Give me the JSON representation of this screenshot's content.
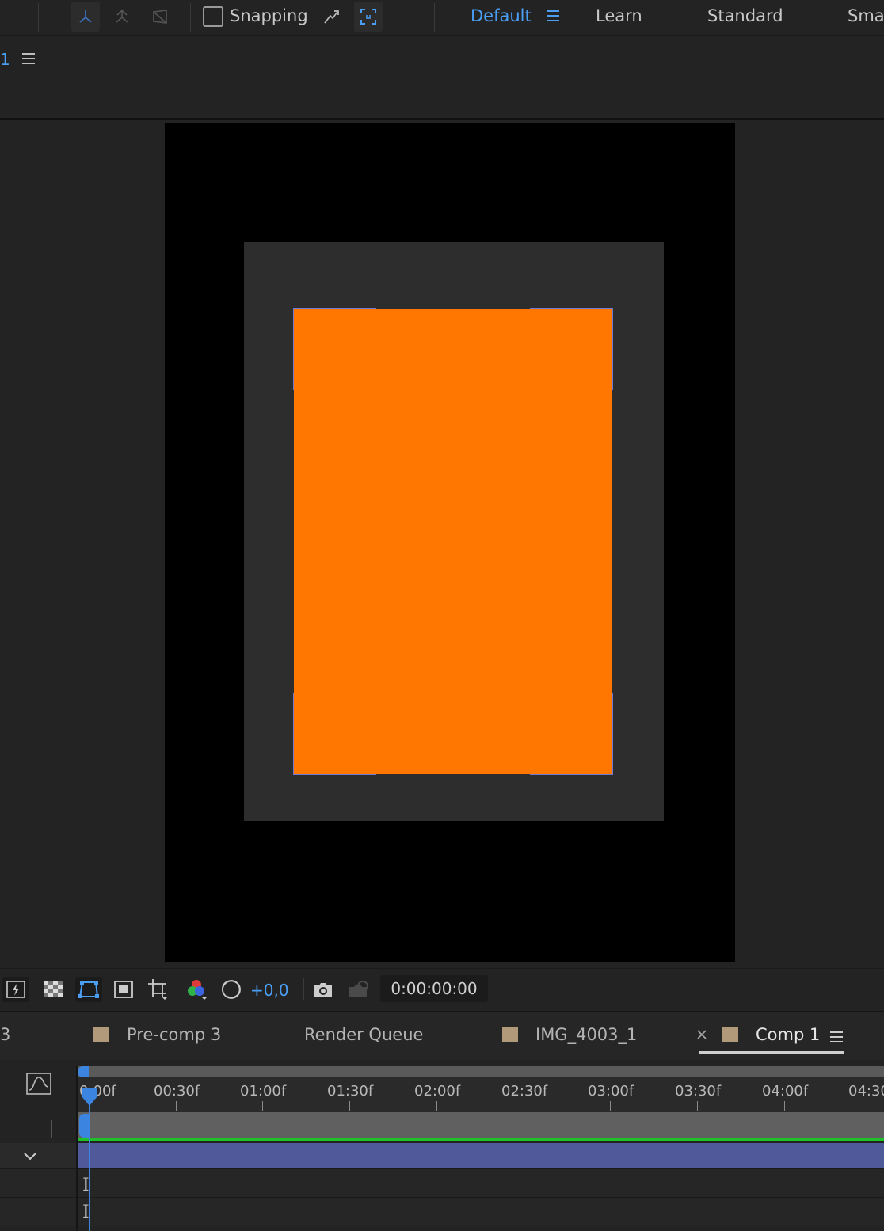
{
  "toolbar": {
    "snapping_label": "Snapping",
    "workspaces": [
      "Default",
      "Learn",
      "Standard",
      "Smal"
    ],
    "active_workspace": "Default",
    "accent": "#4a9ff5"
  },
  "comp_panel": {
    "tab_number": "1"
  },
  "viewer": {
    "exposure_value": "+0,0",
    "timecode": "0:00:00:00",
    "layer_color": "#ff7700"
  },
  "tabs": {
    "partial_left": "3",
    "items": [
      {
        "label": "Pre-comp 3",
        "swatch": "#b09a7a"
      },
      {
        "label": "Render Queue"
      },
      {
        "label": "IMG_4003_1",
        "swatch": "#b09a7a"
      },
      {
        "label": "Comp 1",
        "swatch": "#b09a7a",
        "active": true
      }
    ]
  },
  "timeline": {
    "ruler_labels": [
      "0:00f",
      "00:30f",
      "01:00f",
      "01:30f",
      "02:00f",
      "02:30f",
      "03:00f",
      "03:30f",
      "04:00f",
      "04:30"
    ],
    "work_area_color": "#1fc12a",
    "layer_bar_color": "#50599a"
  }
}
